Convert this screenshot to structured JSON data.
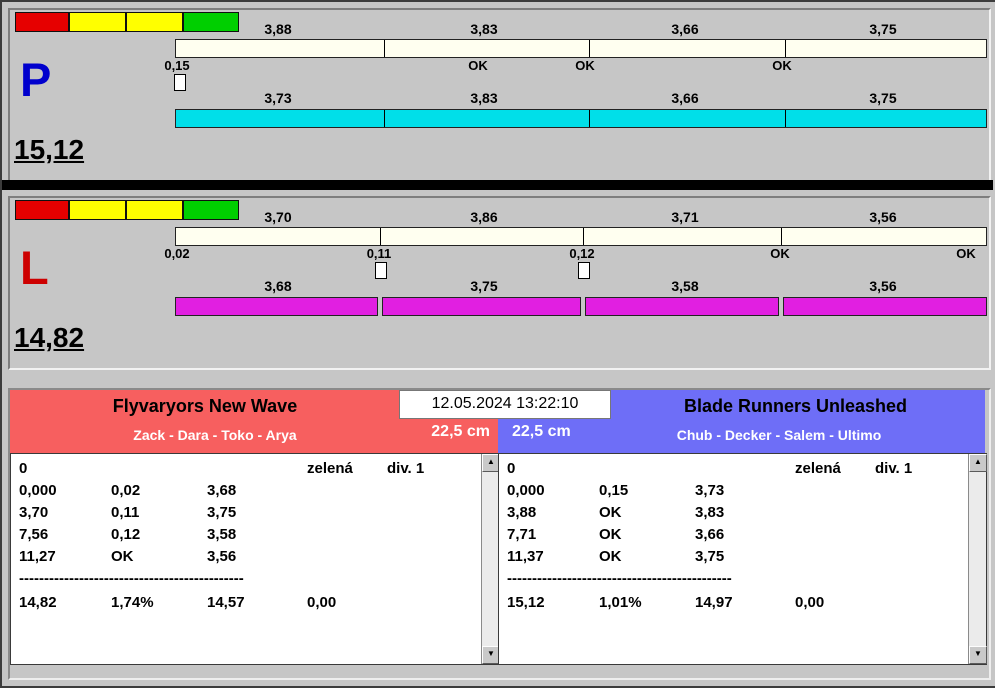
{
  "datetime": "12.05.2024 13:22:10",
  "colors": {
    "traffic_lights": [
      "#e60000",
      "#ffff00",
      "#ffff00",
      "#00cf00"
    ],
    "gross_bar": "#fffff0",
    "lane_p_bar": "#00dfe9",
    "lane_l_bar": "#e11fe1",
    "lane_p_letter": "#0000cd",
    "lane_l_letter": "#cd0000",
    "team_left_header": "#f75f5f",
    "team_right_header": "#6e6ef7"
  },
  "lanes": [
    {
      "letter": "P",
      "total": "15,12",
      "gross_splits": [
        "3,88",
        "3,83",
        "3,66",
        "3,75"
      ],
      "status_labels": [
        "0,15",
        "OK",
        "OK",
        "OK"
      ],
      "net_splits": [
        "3,73",
        "3,83",
        "3,66",
        "3,75"
      ]
    },
    {
      "letter": "L",
      "total": "14,82",
      "gross_splits": [
        "3,70",
        "3,86",
        "3,71",
        "3,56"
      ],
      "status_labels": [
        "0,02",
        "0,11",
        "0,12",
        "OK",
        "OK"
      ],
      "net_splits": [
        "3,68",
        "3,75",
        "3,58",
        "3,56"
      ]
    }
  ],
  "teams": [
    {
      "name": "Flyvaryors New Wave",
      "members": "Zack - Dara - Toko - Arya",
      "height": "22,5 cm",
      "table": {
        "lane_no": "0",
        "color_label": "zelená",
        "division": "div. 1",
        "splits": [
          {
            "cum": "0,000",
            "status": "0,02",
            "net": "3,68"
          },
          {
            "cum": "3,70",
            "status": "0,11",
            "net": "3,75"
          },
          {
            "cum": "7,56",
            "status": "0,12",
            "net": "3,58"
          },
          {
            "cum": "11,27",
            "status": "OK",
            "net": "3,56"
          }
        ],
        "divider": "---------------------------------------------",
        "total": "14,82",
        "percent": "1,74%",
        "net_total": "14,57",
        "penalty": "0,00"
      }
    },
    {
      "name": "Blade Runners Unleashed",
      "members": "Chub - Decker - Salem - Ultimo",
      "height": "22,5 cm",
      "table": {
        "lane_no": "0",
        "color_label": "zelená",
        "division": "div. 1",
        "splits": [
          {
            "cum": "0,000",
            "status": "0,15",
            "net": "3,73"
          },
          {
            "cum": "3,88",
            "status": "OK",
            "net": "3,83"
          },
          {
            "cum": "7,71",
            "status": "OK",
            "net": "3,66"
          },
          {
            "cum": "11,37",
            "status": "OK",
            "net": "3,75"
          }
        ],
        "divider": "---------------------------------------------",
        "total": "15,12",
        "percent": "1,01%",
        "net_total": "14,97",
        "penalty": "0,00"
      }
    }
  ],
  "icons": {
    "scroll_up": "▲",
    "scroll_down": "▼"
  }
}
